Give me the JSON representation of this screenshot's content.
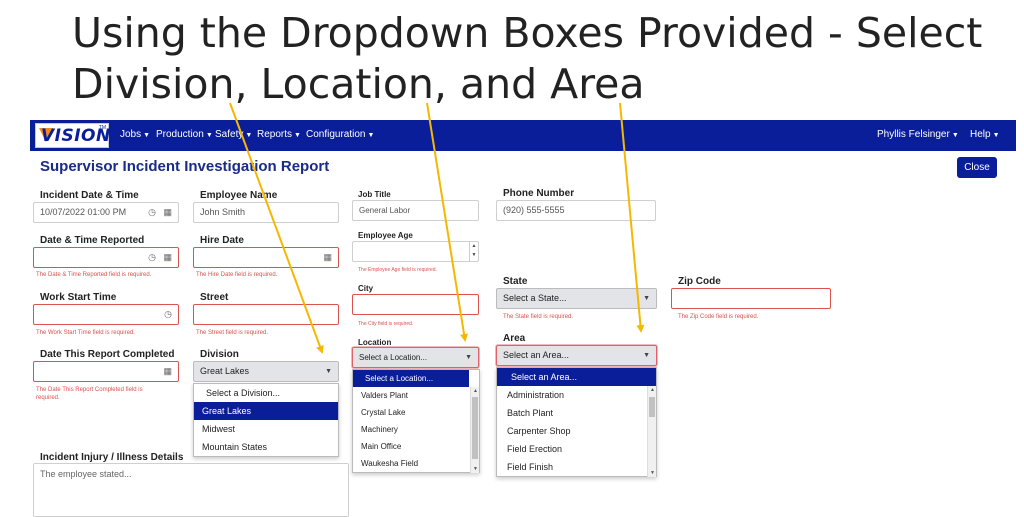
{
  "slide": {
    "title_line1": "Using the Dropdown Boxes Provided - Select",
    "title_line2": "Division, Location, and Area"
  },
  "navbar": {
    "logo_text": "VISION",
    "logo_tm": "TM",
    "menu": [
      "Jobs",
      "Production",
      "Safety",
      "Reports",
      "Configuration"
    ],
    "user": "Phyllis Felsinger",
    "help": "Help"
  },
  "report": {
    "title": "Supervisor Incident Investigation Report",
    "close": "Close"
  },
  "form": {
    "incident_datetime": {
      "label": "Incident Date & Time",
      "value": "10/07/2022 01:00 PM"
    },
    "employee_name": {
      "label": "Employee Name",
      "value": "John Smith"
    },
    "date_reported": {
      "label": "Date & Time Reported",
      "error": "The Date & Time Reported field is required."
    },
    "hire_date": {
      "label": "Hire Date",
      "error": "The Hire Date field is required."
    },
    "work_start": {
      "label": "Work Start Time",
      "error": "The Work Start Time field is required."
    },
    "street": {
      "label": "Street",
      "error": "The Street field is required."
    },
    "report_completed": {
      "label": "Date This Report Completed",
      "error1": "The Date This Report Completed field is",
      "error2": "required."
    },
    "division": {
      "label": "Division",
      "value": "Great Lakes",
      "options": [
        "Select a Division...",
        "Great Lakes",
        "Midwest",
        "Mountain States"
      ],
      "highlighted": "Great Lakes"
    },
    "job_title": {
      "label": "Job Title",
      "value": "General Labor"
    },
    "employee_age": {
      "label": "Employee Age",
      "error": "The Employee Age field is required."
    },
    "city": {
      "label": "City",
      "error": "The City field is required."
    },
    "location": {
      "label": "Location",
      "placeholder": "Select a Location...",
      "options": [
        "Select a Location...",
        "Valders Plant",
        "Crystal Lake",
        "Machinery",
        "Main Office",
        "Waukesha Field"
      ],
      "highlighted": "Select a Location..."
    },
    "phone": {
      "label": "Phone Number",
      "value": "(920) 555-5555"
    },
    "state": {
      "label": "State",
      "placeholder": "Select a State...",
      "error": "The State field is required."
    },
    "zip": {
      "label": "Zip Code",
      "error": "The Zip Code field is required."
    },
    "area": {
      "label": "Area",
      "placeholder": "Select an Area...",
      "options": [
        "Select an Area...",
        "Administration",
        "Batch Plant",
        "Carpenter Shop",
        "Field Erection",
        "Field Finish"
      ],
      "highlighted": "Select an Area..."
    },
    "injury": {
      "label": "Incident Injury / Illness Details",
      "value": "The employee stated..."
    }
  },
  "icons": {
    "clock": "clock-icon",
    "calendar": "calendar-icon",
    "caret": "caret-down-icon"
  },
  "colors": {
    "navbar": "#0b1e9a",
    "title": "#1a2b88",
    "error": "#d9534f",
    "arrow": "#f5b800",
    "logo_accent": "#f08a1c"
  }
}
